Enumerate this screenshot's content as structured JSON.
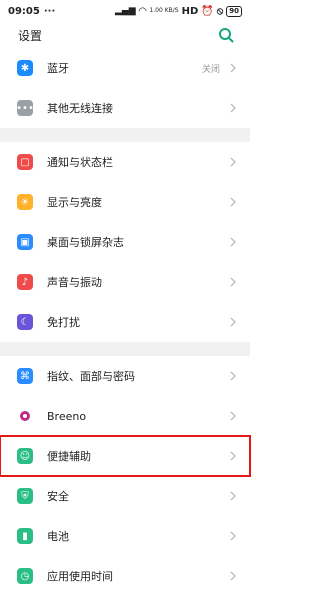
{
  "status_bar": {
    "time": "09:05",
    "net_speed": "1.00 KB/S",
    "network": "HD",
    "battery": "90"
  },
  "header": {
    "title": "设置"
  },
  "sections": [
    {
      "items": [
        {
          "label": "蓝牙",
          "right_text": "关闭",
          "icon": "bluetooth-icon",
          "color": "#1a8cff"
        },
        {
          "label": "其他无线连接",
          "icon": "more-connections-icon",
          "color": "#9aa0a6"
        }
      ]
    },
    {
      "items": [
        {
          "label": "通知与状态栏",
          "icon": "notification-icon",
          "color": "#f04b4b"
        },
        {
          "label": "显示与亮度",
          "icon": "brightness-icon",
          "color": "#ffb12a"
        },
        {
          "label": "桌面与锁屏杂志",
          "icon": "wallpaper-icon",
          "color": "#2a8cff"
        },
        {
          "label": "声音与振动",
          "icon": "sound-icon",
          "color": "#f04b4b"
        },
        {
          "label": "免打扰",
          "icon": "moon-icon",
          "color": "#6a55d8"
        }
      ]
    },
    {
      "items": [
        {
          "label": "指纹、面部与密码",
          "icon": "fingerprint-icon",
          "color": "#2a8cff"
        },
        {
          "label": "Breeno",
          "icon": "breeno-icon",
          "color": "#c12a88"
        },
        {
          "label": "便捷辅助",
          "icon": "assist-icon",
          "color": "#2bbd86",
          "highlight": true
        },
        {
          "label": "安全",
          "icon": "security-icon",
          "color": "#2bbd86"
        },
        {
          "label": "电池",
          "icon": "battery-icon",
          "color": "#2bbd86"
        },
        {
          "label": "应用使用时间",
          "icon": "time-icon",
          "color": "#2bbd86"
        }
      ]
    }
  ]
}
